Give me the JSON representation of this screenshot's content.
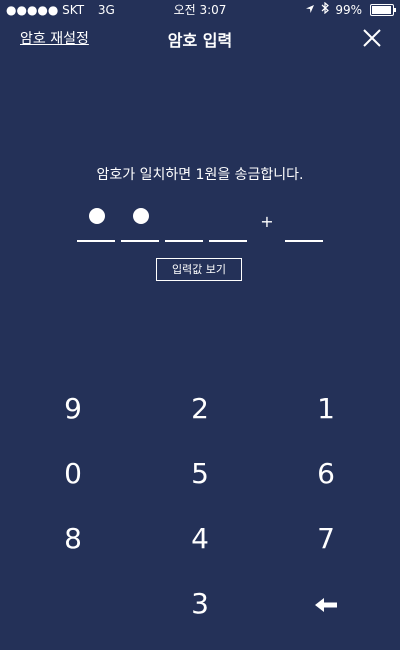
{
  "status_bar": {
    "carrier": "●●●●● SKT",
    "network": "3G",
    "time": "오전 3:07",
    "battery": "99%",
    "battery_level": 0.99
  },
  "header": {
    "reset_link": "암호 재설정",
    "title": "암호 입력",
    "close_icon": "close-icon"
  },
  "instruction": "암호가 일치하면 1원을 송금합니다.",
  "pin": {
    "filled_count": 2,
    "slot_count": 5,
    "separator": "+"
  },
  "show_input_button": "입력값 보기",
  "keypad": {
    "keys": [
      "9",
      "2",
      "1",
      "0",
      "5",
      "6",
      "8",
      "4",
      "7",
      "3"
    ],
    "backspace_icon": "backspace-arrow-icon"
  }
}
